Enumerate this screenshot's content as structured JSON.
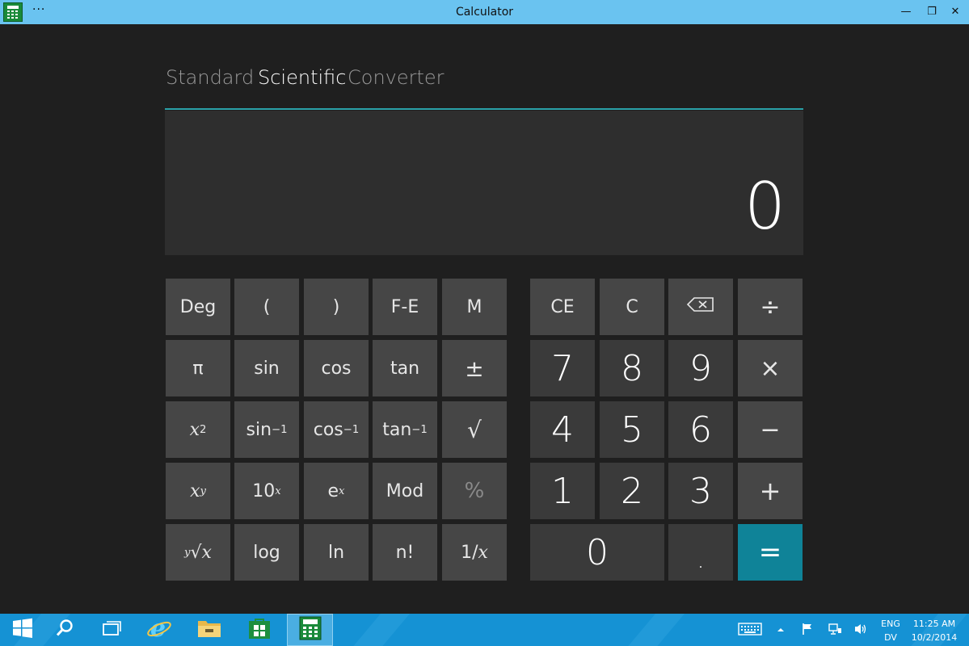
{
  "window": {
    "title": "Calculator",
    "menu_glyph": "···",
    "minimize": "—",
    "maximize": "❐",
    "close": "✕"
  },
  "tabs": [
    {
      "label": "Standard",
      "active": false
    },
    {
      "label": "Scientific",
      "active": true
    },
    {
      "label": "Converter",
      "active": false
    }
  ],
  "display": {
    "value": "0"
  },
  "keys": {
    "deg": "Deg",
    "lparen": "(",
    "rparen": ")",
    "fe": "F-E",
    "m": "M",
    "pi": "π",
    "sin": "sin",
    "cos": "cos",
    "tan": "tan",
    "plusminus": "±",
    "x2_base": "x",
    "x2_exp": "2",
    "asin_base": "sin",
    "asin_exp": "−1",
    "acos_base": "cos",
    "acos_exp": "−1",
    "atan_base": "tan",
    "atan_exp": "−1",
    "sqrt": "√",
    "xy_base": "x",
    "xy_exp": "y",
    "tenx_base": "10",
    "tenx_exp": "x",
    "ex_base": "e",
    "ex_exp": "x",
    "mod": "Mod",
    "percent": "%",
    "yroot_idx": "y",
    "yroot_rad": "√",
    "yroot_x": "x",
    "log": "log",
    "ln": "ln",
    "fact": "n!",
    "recip_one": "1/",
    "recip_x": "x",
    "ce": "CE",
    "c": "C",
    "backspace": "⌫",
    "divide": "÷",
    "n7": "7",
    "n8": "8",
    "n9": "9",
    "multiply": "×",
    "n4": "4",
    "n5": "5",
    "n6": "6",
    "minus": "−",
    "n1": "1",
    "n2": "2",
    "n3": "3",
    "plus": "+",
    "n0": "0",
    "dot": ".",
    "equals": "="
  },
  "taskbar": {
    "lang_top": "ENG",
    "lang_bottom": "DV",
    "time": "11:25 AM",
    "date": "10/2/2014"
  },
  "colors": {
    "titlebar": "#6ac3f0",
    "accent": "#0f8398",
    "taskbar": "#1592d4"
  }
}
